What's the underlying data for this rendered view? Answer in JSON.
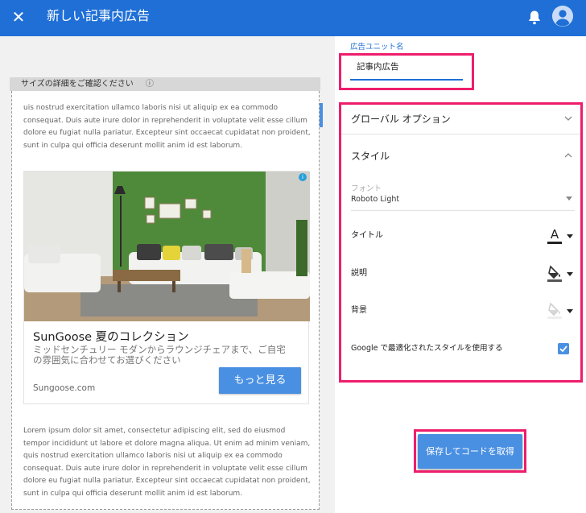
{
  "header": {
    "close_icon": "close-icon",
    "title": "新しい記事内広告",
    "bell_icon": "bell-icon",
    "avatar_icon": "account-avatar-icon"
  },
  "preview": {
    "size_header": "サイズの詳細をご確認ください",
    "help_icon": "help-circle-icon",
    "paragraph_top": "uis nostrud exercitation ullamco laboris nisi ut aliquip ex ea commodo consequat. Duis aute irure dolor in reprehenderit in voluptate velit esse cillum dolore eu fugiat nulla pariatur. Excepteur sint occaecat cupidatat non proident, sunt in culpa qui officia deserunt mollit anim id est laborum.",
    "ad": {
      "image_icon": "living-room-photo",
      "adchoices_icon": "adchoices-icon",
      "title": "SunGoose 夏のコレクション",
      "description": "ミッドセンチュリー モダンからラウンジチェアまで、ご自宅の雰囲気に合わせてお選びください",
      "domain": "Sungoose.com",
      "cta": "もっと見る"
    },
    "paragraph_bottom": "Lorem ipsum dolor sit amet, consectetur adipiscing elit, sed do eiusmod tempor incididunt ut labore et dolore magna aliqua. Ut enim ad minim veniam, quis nostrud exercitation ullamco laboris nisi ut aliquip ex ea commodo consequat. Duis aute irure dolor in reprehenderit in voluptate velit esse cillum dolore eu fugiat nulla pariatur. Excepteur sint occaecat cupidatat non proident, sunt in culpa qui officia deserunt mollit anim id est laborum."
  },
  "settings": {
    "unit_name_label": "広告ユニット名",
    "unit_name_value": "記事内広告",
    "global_options": "グローバル オプション",
    "style_section": "スタイル",
    "font_label": "フォント",
    "font_value": "Roboto Light",
    "title_label": "タイトル",
    "description_label": "説明",
    "background_label": "背景",
    "google_optimized_label": "Google で最適化されたスタイルを使用する",
    "google_optimized_checked": true,
    "save_button": "保存してコードを取得"
  },
  "colors": {
    "accent": "#1f6fd6",
    "button": "#4a90e2",
    "highlight": "#ee1d6c"
  }
}
